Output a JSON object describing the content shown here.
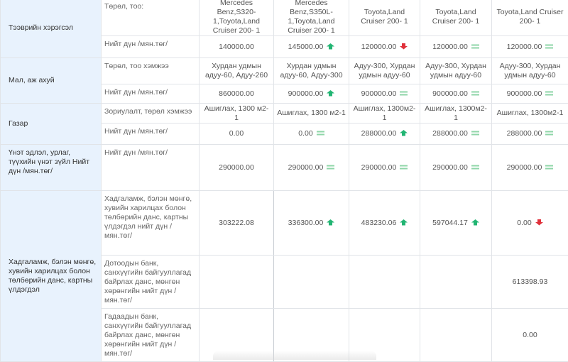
{
  "sections": {
    "vehicles": {
      "label": "Тээврийн хэрэгсэл",
      "r1_label": "Төрөл, тоо:",
      "r1": [
        "Mercedes Benz,S320-1,Toyota,Land Cruiser 200- 1",
        "Mercedes Benz,S350L-1,Toyota,Land Cruiser 200- 1",
        "Toyota,Land Cruiser 200- 1",
        "Toyota,Land Cruiser 200- 1",
        "Toyota,Land Cruiser 200- 1"
      ],
      "r2_label": "Нийт дүн /мян.төг/",
      "r2": [
        "140000.00",
        "145000.00",
        "120000.00",
        "120000.00",
        "120000.00"
      ],
      "r2_ind": [
        "none",
        "up",
        "down",
        "eq",
        "eq"
      ]
    },
    "livestock": {
      "label": "Мал, аж ахуй",
      "r1_label": "Төрөл, тоо хэмжээ",
      "r1": [
        "Хурдан удмын адуу-60, Адуу-260",
        "Хурдан удмын адуу-60, Адуу-300",
        "Адуу-300, Хурдан удмын адуу-60",
        "Адуу-300, Хурдан удмын адуу-60",
        "Адуу-300, Хурдан удмын адуу-60"
      ],
      "r2_label": "Нийт дүн /мян.төг/",
      "r2": [
        "860000.00",
        "900000.00",
        "900000.00",
        "900000.00",
        "900000.00"
      ],
      "r2_ind": [
        "none",
        "up",
        "eq",
        "eq",
        "eq"
      ]
    },
    "land": {
      "label": "Газар",
      "r1_label": "Зориулалт, төрөл хэмжээ",
      "r1": [
        "Ашиглах, 1300 м2-1",
        "Ашиглах, 1300 м2-1",
        "Ашиглах, 1300м2-1",
        "Ашиглах, 1300м2-1",
        "Ашиглах, 1300м2-1"
      ],
      "r2_label": "Нийт дүн /мян.төг/",
      "r2": [
        "0.00",
        "0.00",
        "288000.00",
        "288000.00",
        "288000.00"
      ],
      "r2_ind": [
        "none",
        "eq",
        "up",
        "eq",
        "eq"
      ]
    },
    "jewelry": {
      "label": "Үнэт эдлэл, урлаг, түүхийн үнэт зүйл Нийт дүн /мян.төг/",
      "r1_label": "Нийт дүн /мян.төг/",
      "r1": [
        "290000.00",
        "290000.00",
        "290000.00",
        "290000.00",
        "290000.00"
      ],
      "r1_ind": [
        "none",
        "eq",
        "eq",
        "eq",
        "eq"
      ]
    },
    "savings": {
      "label": "Хадгаламж, бэлэн мөнгө, хувийн харилцах болон төлбөрийн данс, картны үлдэгдэл",
      "r1_label": "Хадгаламж, бэлэн мөнгө, хувийн харилцах болон төлбөрийн данс, картны үлдэгдэл нийт дүн /мян.төг/",
      "r1": [
        "303222.08",
        "336300.00",
        "483230.06",
        "597044.17",
        "0.00"
      ],
      "r1_ind": [
        "none",
        "up",
        "up",
        "up",
        "down"
      ],
      "r2_label": "Дотоодын банк, санхүүгийн байгууллагад байрлах данс, мөнгөн хөрөнгийн нийт дүн /мян.төг/",
      "r2": [
        "",
        "",
        "",
        "",
        "613398.93"
      ],
      "r3_label": "Гадаадын банк, санхүүгийн байгууллагад байрлах данс, мөнгөн хөрөнгийн нийт дүн /мян.төг/",
      "r3": [
        "",
        "",
        "",
        "",
        "0.00"
      ]
    }
  },
  "indicator_colors": {
    "up": "#22b573",
    "down": "#e0313b",
    "eq": "#8fd6a8"
  }
}
